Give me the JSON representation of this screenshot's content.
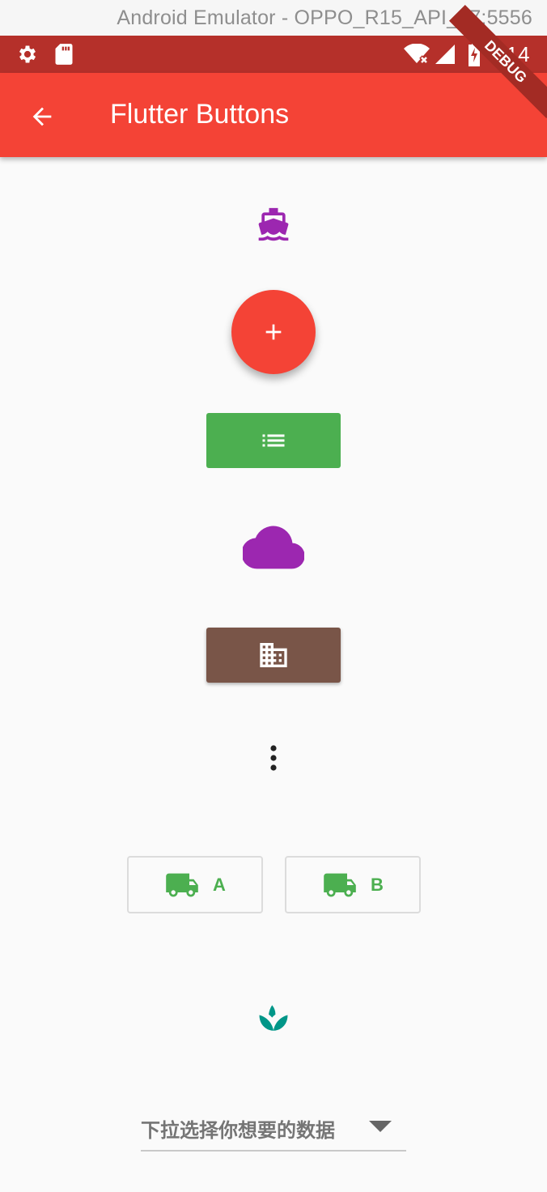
{
  "emulator": {
    "title": "Android Emulator - OPPO_R15_API_27:5556"
  },
  "status_bar": {
    "time": "4:14",
    "icons": [
      "settings-icon",
      "sd-card-icon",
      "wifi-off-icon",
      "signal-icon",
      "battery-charging-icon"
    ]
  },
  "debug_banner": "DEBUG",
  "app_bar": {
    "title": "Flutter Buttons"
  },
  "buttons": {
    "icon_button_icon": "boat-icon",
    "fab_icon": "add-icon",
    "list_button_icon": "list-icon",
    "cloud_button_icon": "cloud-icon",
    "building_button_icon": "building-icon",
    "more_icon": "more-vert-icon",
    "outline_a_label": "A",
    "outline_b_label": "B",
    "spa_icon": "spa-icon"
  },
  "colors": {
    "app_bar": "#f44336",
    "status_bar": "#b5302a",
    "boat": "#9c27b0",
    "fab": "#f44336",
    "list_button": "#4caf50",
    "cloud": "#9c27b0",
    "building_button": "#795548",
    "truck": "#4caf50",
    "spa": "#009688"
  },
  "dropdown": {
    "hint": "下拉选择你想要的数据"
  }
}
